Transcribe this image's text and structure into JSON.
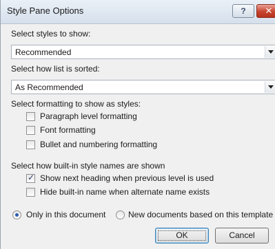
{
  "window": {
    "title": "Style Pane Options",
    "help_glyph": "?",
    "close_glyph": "✕"
  },
  "select_styles": {
    "label": "Select styles to show:",
    "value": "Recommended",
    "icon": "chevron-down-icon"
  },
  "sort": {
    "label": "Select how list is sorted:",
    "value": "As Recommended",
    "icon": "chevron-down-icon"
  },
  "formatting": {
    "label": "Select formatting to show as styles:",
    "options": [
      {
        "label": "Paragraph level formatting",
        "checked": false
      },
      {
        "label": "Font formatting",
        "checked": false
      },
      {
        "label": "Bullet and numbering formatting",
        "checked": false
      }
    ]
  },
  "builtin": {
    "label": "Select how built-in style names are shown",
    "options": [
      {
        "label": "Show next heading when previous level is used",
        "checked": true
      },
      {
        "label": "Hide built-in name when alternate name exists",
        "checked": false
      }
    ]
  },
  "scope": {
    "options": [
      {
        "label": "Only in this document",
        "selected": true
      },
      {
        "label": "New documents based on this template",
        "selected": false
      }
    ]
  },
  "buttons": {
    "ok": "OK",
    "cancel": "Cancel"
  }
}
